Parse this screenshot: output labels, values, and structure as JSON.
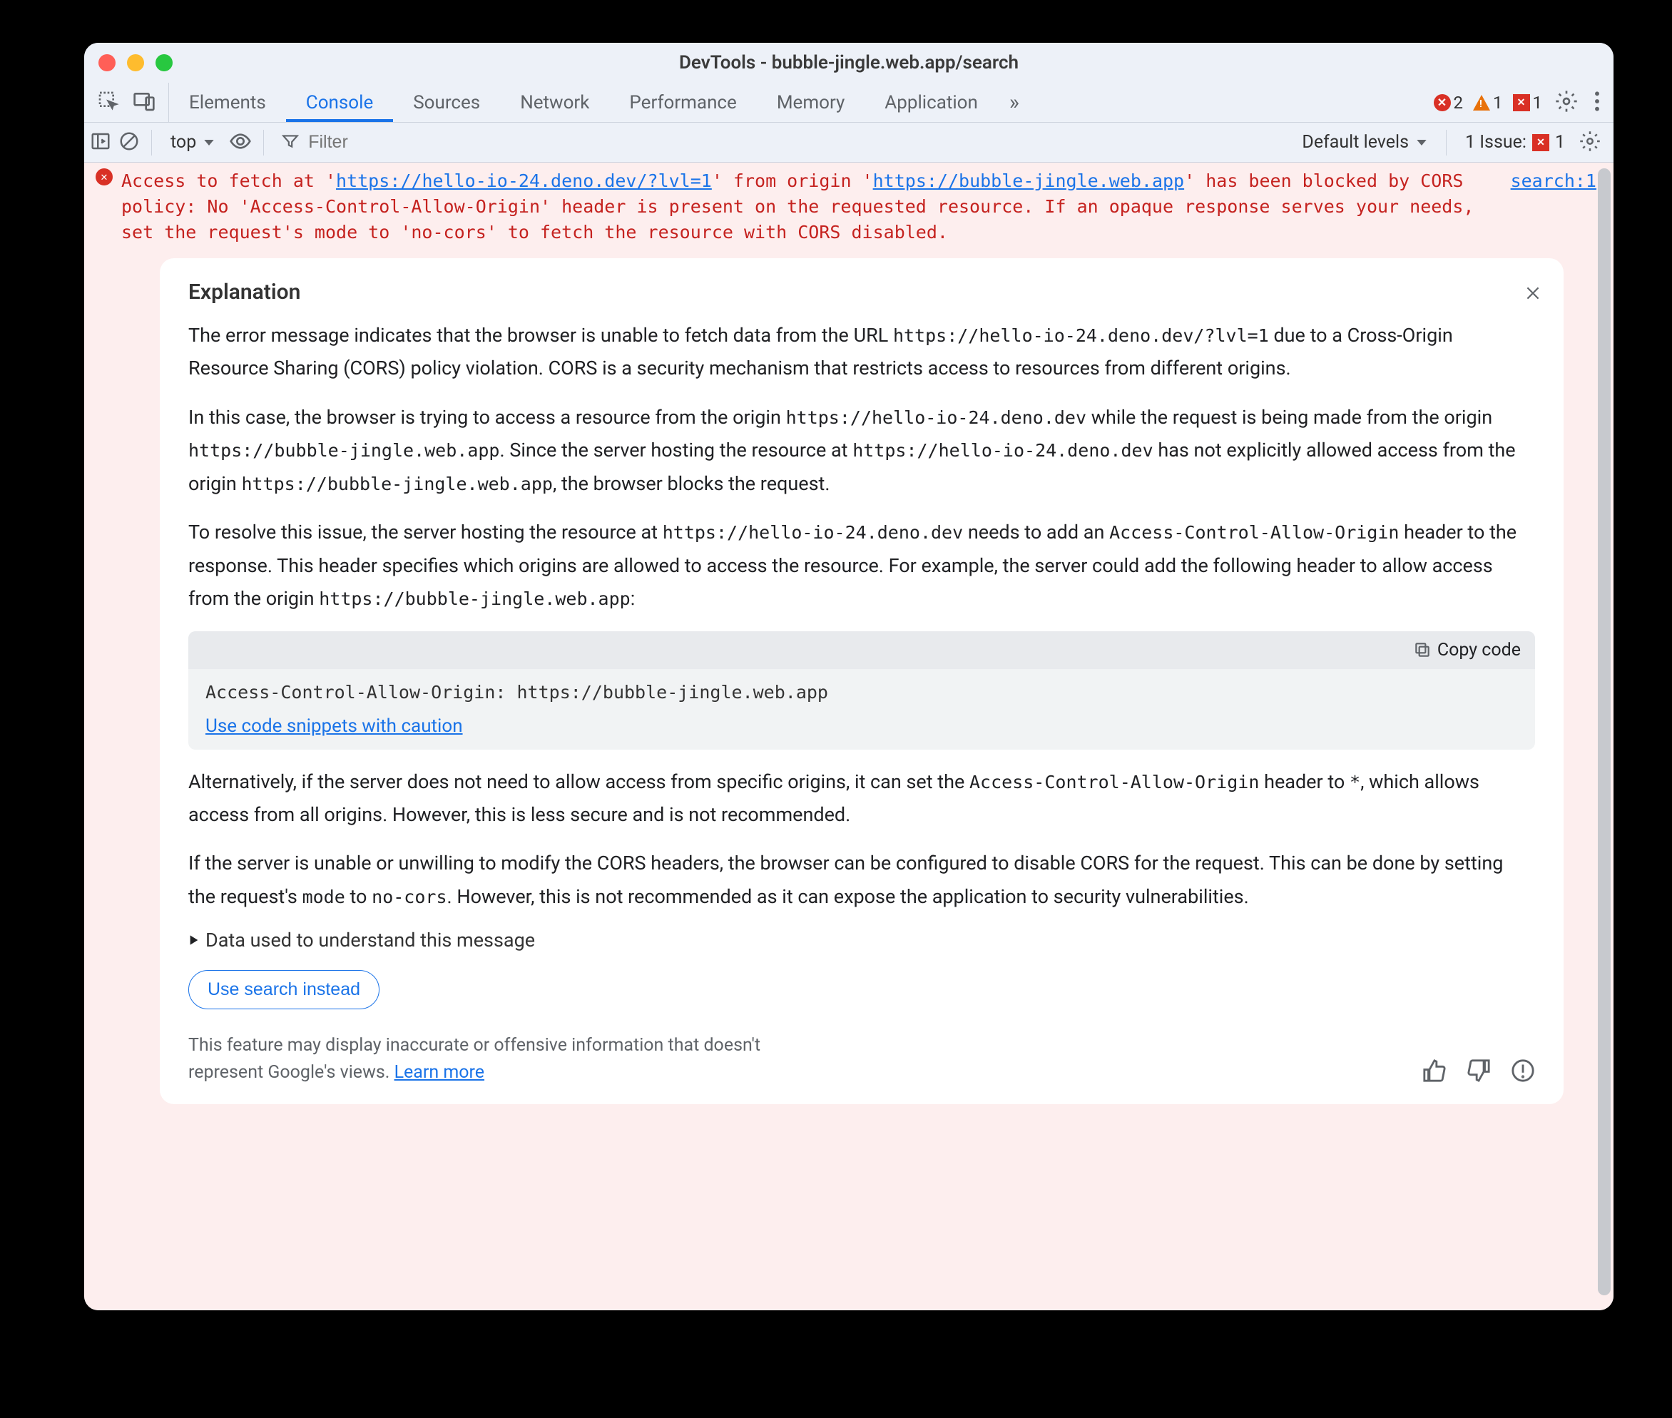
{
  "window": {
    "title": "DevTools - bubble-jingle.web.app/search"
  },
  "tabs": {
    "items": [
      "Elements",
      "Console",
      "Sources",
      "Network",
      "Performance",
      "Memory",
      "Application"
    ],
    "active_index": 1
  },
  "counters": {
    "errors": "2",
    "warnings": "1",
    "issues_badge": "1"
  },
  "toolbar": {
    "context": "top",
    "filter_placeholder": "Filter",
    "levels": "Default levels",
    "issues_label": "1 Issue:",
    "issues_count": "1"
  },
  "error": {
    "pre1": "Access to fetch at '",
    "url1": "https://hello-io-24.deno.dev/?lvl=1",
    "mid1": "' from origin '",
    "url2": "https://bubble-jingle.web.app",
    "post1": "' has been blocked by CORS policy: No 'Access-Control-Allow-Origin' header is present on the requested resource. If an opaque response serves your needs, set the request's mode to 'no-cors' to fetch the resource with CORS disabled.",
    "source": "search:1"
  },
  "explanation": {
    "title": "Explanation",
    "p1a": "The error message indicates that the browser is unable to fetch data from the URL ",
    "p1code": "https://hello-io-24.deno.dev/?lvl=1",
    "p1b": " due to a Cross-Origin Resource Sharing (CORS) policy violation. CORS is a security mechanism that restricts access to resources from different origins.",
    "p2a": "In this case, the browser is trying to access a resource from the origin ",
    "p2code1": "https://hello-io-24.deno.dev",
    "p2b": " while the request is being made from the origin ",
    "p2code2": "https://bubble-jingle.web.app",
    "p2c": ". Since the server hosting the resource at ",
    "p2code3": "https://hello-io-24.deno.dev",
    "p2d": " has not explicitly allowed access from the origin ",
    "p2code4": "https://bubble-jingle.web.app",
    "p2e": ", the browser blocks the request.",
    "p3a": "To resolve this issue, the server hosting the resource at ",
    "p3code1": "https://hello-io-24.deno.dev",
    "p3b": " needs to add an ",
    "p3code2": "Access-Control-Allow-Origin",
    "p3c": " header to the response. This header specifies which origins are allowed to access the resource. For example, the server could add the following header to allow access from the origin ",
    "p3code3": "https://bubble-jingle.web.app",
    "p3d": ":",
    "copy_label": "Copy code",
    "code": "Access-Control-Allow-Origin: https://bubble-jingle.web.app",
    "caution": "Use code snippets with caution",
    "p4a": "Alternatively, if the server does not need to allow access from specific origins, it can set the ",
    "p4code1": "Access-Control-Allow-Origin",
    "p4b": " header to ",
    "p4code2": "*",
    "p4c": ", which allows access from all origins. However, this is less secure and is not recommended.",
    "p5a": "If the server is unable or unwilling to modify the CORS headers, the browser can be configured to disable CORS for the request. This can be done by setting the request's ",
    "p5code1": "mode",
    "p5b": " to ",
    "p5code2": "no-cors",
    "p5c": ". However, this is not recommended as it can expose the application to security vulnerabilities.",
    "details": "Data used to understand this message",
    "action": "Use search instead",
    "disclaimer": "This feature may display inaccurate or offensive information that doesn't represent Google's views. ",
    "learn_more": "Learn more"
  }
}
